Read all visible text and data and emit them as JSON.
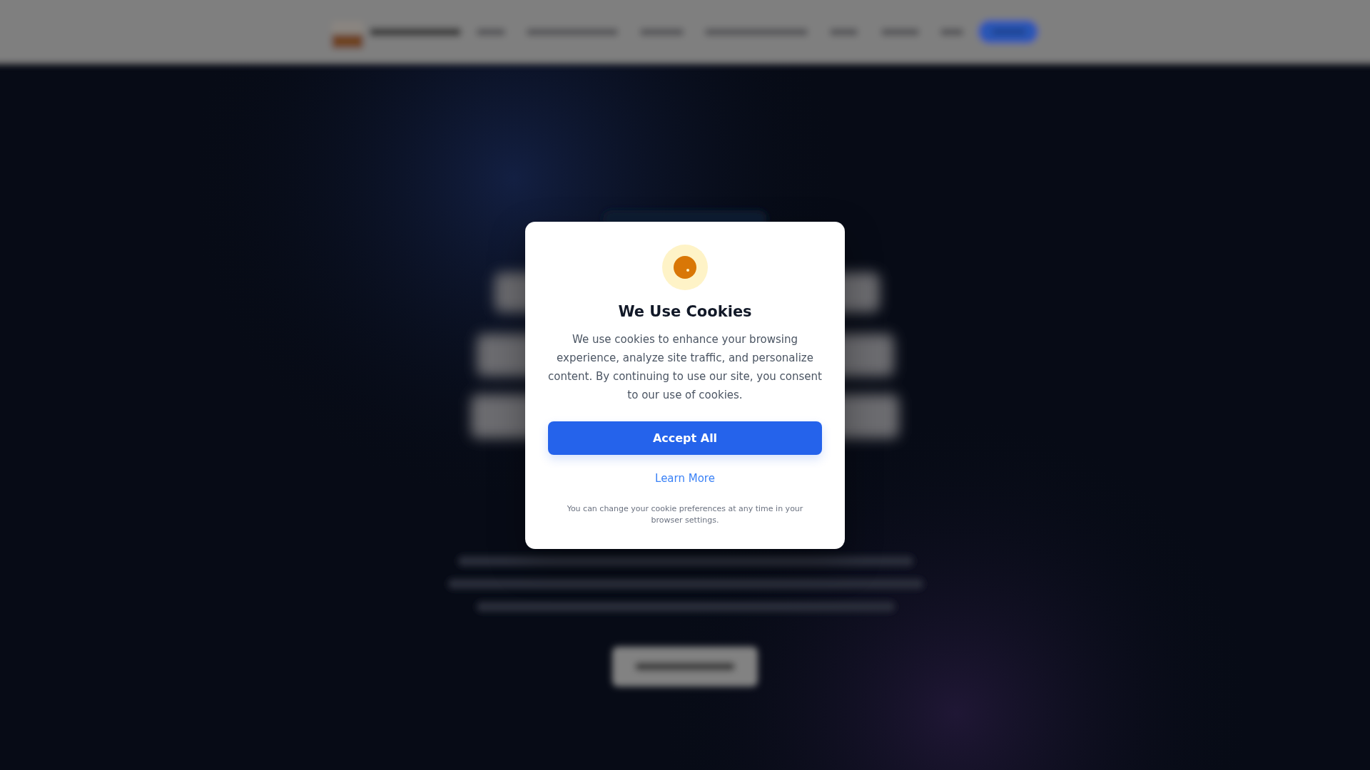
{
  "cookie_dialog": {
    "title": "We Use Cookies",
    "message": "We use cookies to enhance your browsing experience, analyze site traffic, and personalize content. By continuing to use our site, you consent to our use of cookies.",
    "buttons": [
      {
        "kind": "primary",
        "label": "Accept All"
      },
      {
        "kind": "link",
        "label": "Learn More"
      }
    ],
    "footnote": "You can change your cookie preferences at any time in your browser settings."
  }
}
